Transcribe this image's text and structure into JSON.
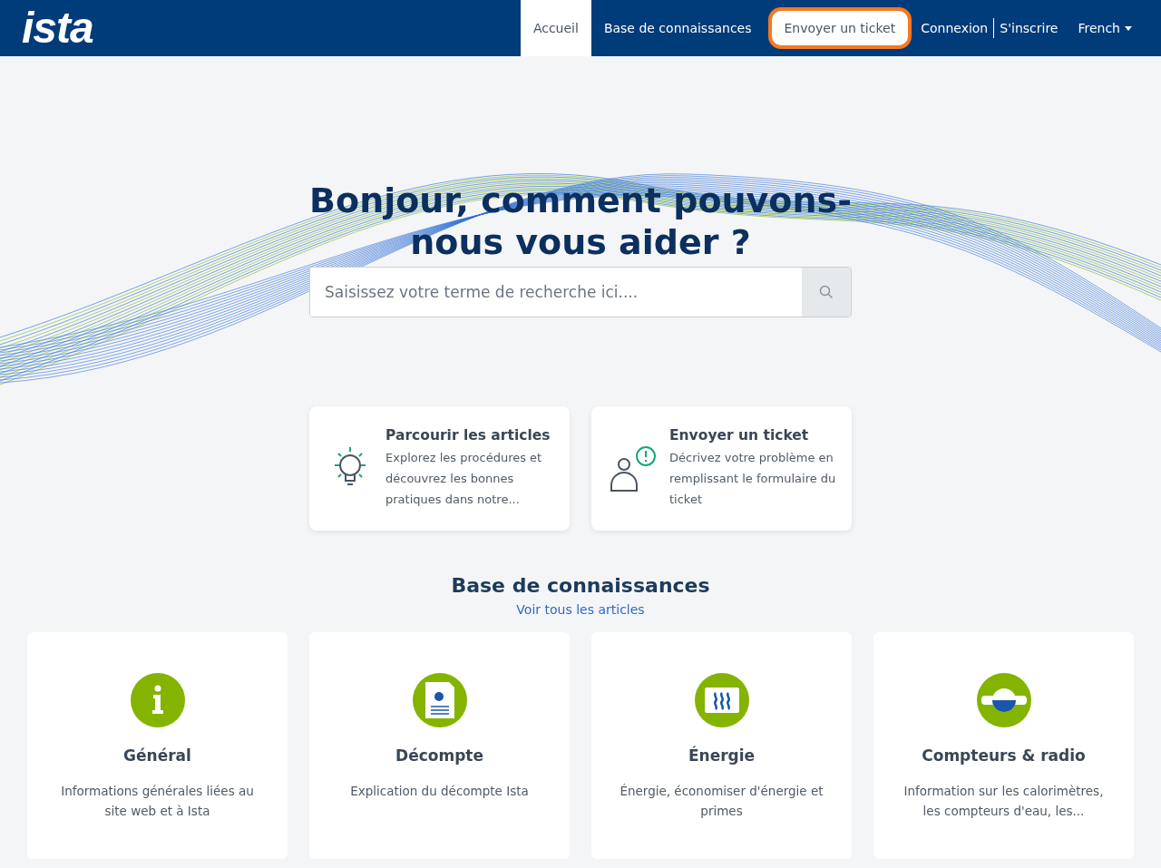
{
  "header": {
    "logo": "ista",
    "nav": [
      {
        "label": "Accueil",
        "selected": true,
        "highlighted": false
      },
      {
        "label": "Base de connaissances",
        "selected": false,
        "highlighted": false
      },
      {
        "label": "Envoyer un ticket",
        "selected": false,
        "highlighted": true
      }
    ],
    "auth": [
      "Connexion",
      "S'inscrire"
    ],
    "language": "French"
  },
  "hero": {
    "title": "Bonjour, comment pouvons-nous vous aider ?",
    "search": {
      "placeholder": "Saisissez votre terme de recherche ici...."
    }
  },
  "actions": [
    {
      "kind": "bulb",
      "title": "Parcourir les articles",
      "text": "Explorez les procédures et découvrez les bonnes pratiques dans notre..."
    },
    {
      "kind": "person",
      "title": "Envoyer un ticket",
      "text": "Décrivez votre problème en remplissant le formulaire du ticket"
    }
  ],
  "knowledge": {
    "title": "Base de connaissances",
    "link": "Voir tous les articles",
    "categories": [
      {
        "kind": "info",
        "title": "Général",
        "text": "Informations générales liées au site web et à Ista"
      },
      {
        "kind": "document",
        "title": "Décompte",
        "text": "Explication du décompte Ista"
      },
      {
        "kind": "heating",
        "title": "Énergie",
        "text": "Énergie, économiser d'énergie et primes"
      },
      {
        "kind": "meter",
        "title": "Compteurs & radio",
        "text": "Information sur les calorimètres, les compteurs d'eau, les..."
      }
    ]
  }
}
